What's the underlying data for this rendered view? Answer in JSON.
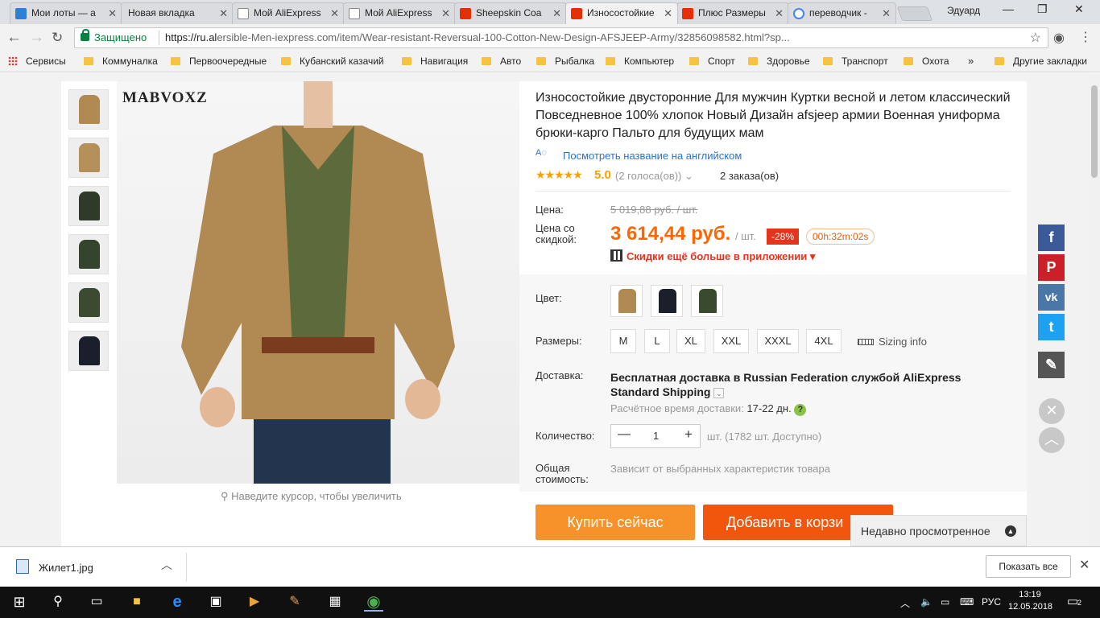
{
  "browser": {
    "tabs": [
      {
        "label": "Мои лоты — a",
        "icon": "auction-icon",
        "color": "#2f7ed8"
      },
      {
        "label": "Новая вкладка",
        "icon": "none",
        "color": ""
      },
      {
        "label": "Мой AliExpress",
        "icon": "page-icon",
        "color": "#888888"
      },
      {
        "label": "Мой AliExpress",
        "icon": "page-icon",
        "color": "#888888"
      },
      {
        "label": "Sheepskin Coa",
        "icon": "aliexpress-icon",
        "color": "#e62e04"
      },
      {
        "label": "Износостойкие",
        "icon": "aliexpress-icon",
        "color": "#e62e04"
      },
      {
        "label": "Плюс Размеры",
        "icon": "aliexpress-icon",
        "color": "#e62e04"
      },
      {
        "label": "переводчик - ",
        "icon": "google-icon",
        "color": "#4285f4"
      }
    ],
    "window_user": "Эдуард",
    "secure_label": "Защищено",
    "url_prefix": "https://ru.al",
    "url_rest": "ersible-Men-iexpress.com/item/Wear-resistant-Reversual-100-Cotton-New-Design-AFSJEEP-Army/32856098582.html?sp...",
    "bookmarks": [
      "Сервисы",
      "Коммуналка",
      "Первоочередные",
      "Кубанский казачий",
      "Навигация",
      "Авто",
      "Рыбалка",
      "Компьютер",
      "Спорт",
      "Здоровье",
      "Транспорт",
      "Охота"
    ],
    "bookmarks_more": "»",
    "other_bookmarks": "Другие закладки"
  },
  "product": {
    "brand": "MABVOXZ",
    "zoom_hint": "Наведите курсор, чтобы увеличить",
    "title": "Износостойкие двусторонние Для мужчин Куртки весной и летом классический Повседневное 100% хлопок Новый Дизайн afsjeep армии Военная униформа брюки-карго Пальто для будущих мам",
    "view_english": "Посмотреть название на английском",
    "stars": "★★★★★",
    "rating": "5.0",
    "votes": "(2 голоса(ов))",
    "orders": "2 заказа(ов)",
    "price_label": "Цена:",
    "old_price": "5 019,88 руб. / шт.",
    "discount_price_label_1": "Цена со",
    "discount_price_label_2": "скидкой:",
    "price": "3 614,44 руб.",
    "unit": "/ шт.",
    "discount": "-28%",
    "timer": "00h:32m:02s",
    "app_deal": "Скидки ещё больше в приложении ▾",
    "color_label": "Цвет:",
    "colors": [
      "#b08a52",
      "#1a1f2b",
      "#3a4a2e"
    ],
    "size_label": "Размеры:",
    "sizes": [
      "M",
      "L",
      "XL",
      "XXL",
      "XXXL",
      "4XL"
    ],
    "sizing_info": "Sizing info",
    "delivery_label": "Доставка:",
    "delivery_text": "Бесплатная доставка в Russian Federation службой AliExpress Standard Shipping",
    "delivery_time_label": "Расчётное время доставки:",
    "delivery_time": "17-22 дн.",
    "qty_label": "Количество:",
    "qty_value": "1",
    "qty_available": "шт. (1782 шт. Доступно)",
    "total_label_1": "Общая",
    "total_label_2": "стоимость:",
    "total_value": "Зависит от выбранных характеристик товара",
    "buy_now": "Купить сейчас",
    "add_to_cart": "Добавить в корзи",
    "recently_viewed": "Недавно просмотренное"
  },
  "downloads": {
    "file": "Жилет1.jpg",
    "show_all": "Показать все"
  },
  "taskbar": {
    "lang": "РУС",
    "time": "13:19",
    "date": "12.05.2018",
    "notifications": "2"
  }
}
